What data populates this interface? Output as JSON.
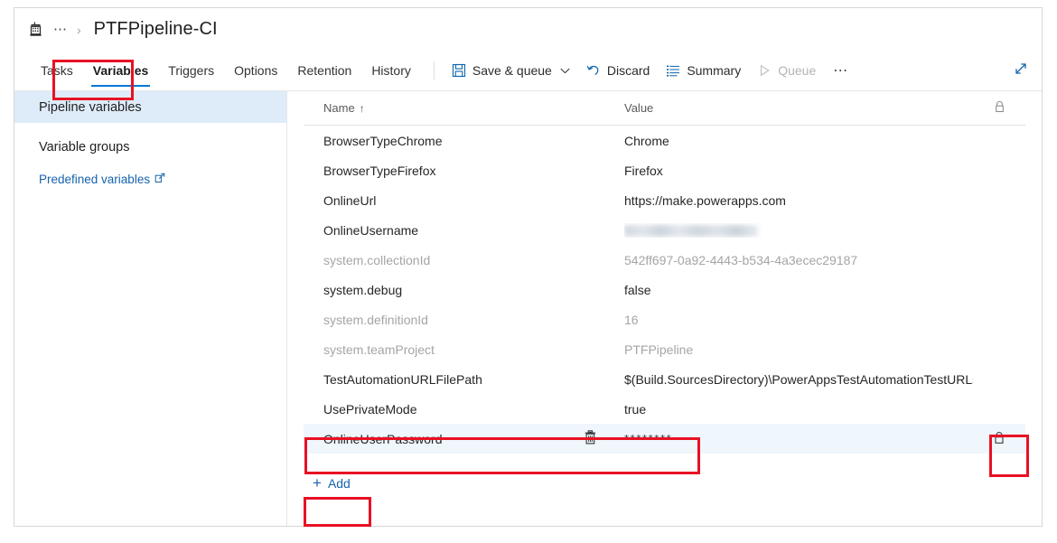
{
  "breadcrumb": {
    "pipeline_icon": "pipeline-icon",
    "ellipsis": "⋯",
    "chevron": "›",
    "title": "PTFPipeline-CI"
  },
  "tabs": [
    {
      "label": "Tasks",
      "selected": false
    },
    {
      "label": "Variables",
      "selected": true
    },
    {
      "label": "Triggers",
      "selected": false
    },
    {
      "label": "Options",
      "selected": false
    },
    {
      "label": "Retention",
      "selected": false
    },
    {
      "label": "History",
      "selected": false
    }
  ],
  "toolbar": {
    "save_queue_label": "Save & queue",
    "save_queue_caret": "⌄",
    "discard_label": "Discard",
    "summary_label": "Summary",
    "queue_label": "Queue",
    "overflow_label": "⋯",
    "expand_icon": "expand-icon"
  },
  "sidebar": {
    "items": [
      {
        "label": "Pipeline variables",
        "active": true
      },
      {
        "label": "Variable groups",
        "active": false
      }
    ],
    "link": {
      "label": "Predefined variables",
      "icon": "external-link-icon"
    }
  },
  "grid": {
    "columns": {
      "name": "Name",
      "sort_arrow": "↑",
      "value": "Value",
      "lock": "lock-icon"
    },
    "rows": [
      {
        "name": "BrowserTypeChrome",
        "value": "Chrome",
        "dim": false,
        "secret": false,
        "selected": false,
        "locked": false
      },
      {
        "name": "BrowserTypeFirefox",
        "value": "Firefox",
        "dim": false,
        "secret": false,
        "selected": false,
        "locked": false
      },
      {
        "name": "OnlineUrl",
        "value": "https://make.powerapps.com",
        "dim": false,
        "secret": false,
        "selected": false,
        "locked": false
      },
      {
        "name": "OnlineUsername",
        "value": "",
        "dim": false,
        "secret": false,
        "selected": false,
        "locked": false,
        "redacted": true
      },
      {
        "name": "system.collectionId",
        "value": "542ff697-0a92-4443-b534-4a3ecec29187",
        "dim": true,
        "secret": false,
        "selected": false,
        "locked": false
      },
      {
        "name": "system.debug",
        "value": "false",
        "dim": false,
        "secret": false,
        "selected": false,
        "locked": false
      },
      {
        "name": "system.definitionId",
        "value": "16",
        "dim": true,
        "secret": false,
        "selected": false,
        "locked": false
      },
      {
        "name": "system.teamProject",
        "value": "PTFPipeline",
        "dim": true,
        "secret": false,
        "selected": false,
        "locked": false
      },
      {
        "name": "TestAutomationURLFilePath",
        "value": "$(Build.SourcesDirectory)\\PowerAppsTestAutomationTestURLs.json",
        "dim": false,
        "secret": false,
        "selected": false,
        "locked": false
      },
      {
        "name": "UsePrivateMode",
        "value": "true",
        "dim": false,
        "secret": false,
        "selected": false,
        "locked": false
      },
      {
        "name": "OnlineUserPassword",
        "value": "********",
        "dim": false,
        "secret": true,
        "selected": true,
        "locked": true,
        "delete_icon": "trash-icon"
      }
    ]
  },
  "add_button": {
    "plus": "+",
    "label": "Add"
  },
  "colors": {
    "accent": "#0078d4",
    "link": "#1763ab",
    "highlight_box": "#e81123",
    "selected_row": "#eff6fc",
    "sidebar_active": "#deecf9"
  }
}
